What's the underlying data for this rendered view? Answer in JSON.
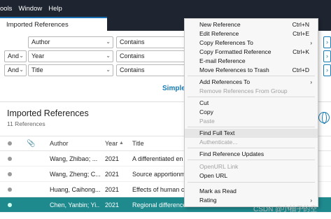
{
  "menubar": {
    "items": [
      "ools",
      "Window",
      "Help"
    ]
  },
  "tabs": {
    "active": "Imported References"
  },
  "search": {
    "rows": [
      {
        "bool": "",
        "field": "Author",
        "op": "Contains"
      },
      {
        "bool": "And",
        "field": "Year",
        "op": "Contains"
      },
      {
        "bool": "And",
        "field": "Title",
        "op": "Contains"
      }
    ],
    "simple_label": "Simple"
  },
  "library": {
    "title": "Imported References",
    "count": "11 References",
    "columns": {
      "author": "Author",
      "year": "Year",
      "title": "Title"
    },
    "rows": [
      {
        "author": "Wang, Zhibao; ...",
        "year": "2021",
        "title": "A differentiated en"
      },
      {
        "author": "Wang, Zheng; C...",
        "year": "2021",
        "title": "Source apportionm"
      },
      {
        "author": "Huang, Caihong...",
        "year": "2021",
        "title": "Effects of human c"
      },
      {
        "author": "Chen, Yanbin; Yi...",
        "year": "2021",
        "title": "Regional differences in the industrial water use efficiency in spa"
      }
    ]
  },
  "context_menu": {
    "items": [
      {
        "label": "New Reference",
        "shortcut": "Ctrl+N",
        "disabled": false
      },
      {
        "label": "Edit Reference",
        "shortcut": "Ctrl+E",
        "disabled": false
      },
      {
        "label": "Copy References To",
        "shortcut": "",
        "disabled": false,
        "submenu": true
      },
      {
        "label": "Copy Formatted Reference",
        "shortcut": "Ctrl+K",
        "disabled": false
      },
      {
        "label": "E-mail Reference",
        "shortcut": "",
        "disabled": false
      },
      {
        "label": "Move References to Trash",
        "shortcut": "Ctrl+D",
        "disabled": false
      },
      {
        "label": "Add References To",
        "shortcut": "",
        "disabled": false,
        "submenu": true
      },
      {
        "label": "Remove References From Group",
        "shortcut": "",
        "disabled": true
      },
      {
        "label": "Cut",
        "shortcut": "",
        "disabled": false
      },
      {
        "label": "Copy",
        "shortcut": "",
        "disabled": false
      },
      {
        "label": "Paste",
        "shortcut": "",
        "disabled": true
      },
      {
        "label": "Find Full Text",
        "shortcut": "",
        "disabled": false,
        "highlighted": true
      },
      {
        "label": "Authenticate...",
        "shortcut": "",
        "disabled": true
      },
      {
        "label": "Find Reference Updates",
        "shortcut": "",
        "disabled": false
      },
      {
        "label": "OpenURL Link",
        "shortcut": "",
        "disabled": true
      },
      {
        "label": "Open URL",
        "shortcut": "",
        "disabled": false
      },
      {
        "label": "Mark as Read",
        "shortcut": "",
        "disabled": false
      },
      {
        "label": "Rating",
        "shortcut": "",
        "disabled": false,
        "submenu": true
      }
    ]
  },
  "watermark": "CSDN @小柚子的空",
  "colors": {
    "accent": "#157bb5",
    "selected_row": "#1f8a8e",
    "menubar": "#1e2530"
  }
}
